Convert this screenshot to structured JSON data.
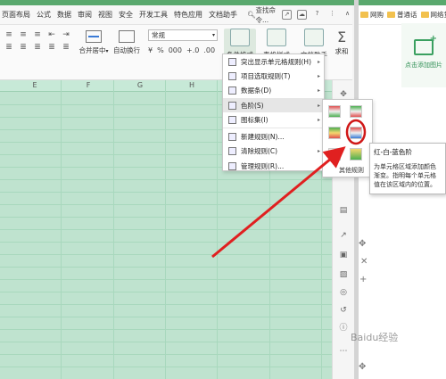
{
  "menu": {
    "items": [
      "页面布局",
      "公式",
      "数据",
      "审阅",
      "视图",
      "安全",
      "开发工具",
      "特色应用",
      "文档助手"
    ],
    "search_label": "查找命令..."
  },
  "ribbon": {
    "merge_label": "合并居中",
    "wrap_label": "自动换行",
    "number_format": "常规",
    "num_buttons": [
      "¥",
      "%",
      "000",
      "+.0",
      ".00"
    ],
    "cond_format_label": "条件格式",
    "table_style_label": "表格样式",
    "doc_helper_label": "文档助手",
    "sum_label": "求和"
  },
  "sheet": {
    "columns": [
      "E",
      "F",
      "G",
      "H"
    ]
  },
  "cond_menu": {
    "items": [
      {
        "label": "突出显示单元格规则(H)",
        "submenu": true
      },
      {
        "label": "项目选取规则(T)",
        "submenu": true
      },
      {
        "label": "数据条(D)",
        "submenu": true
      },
      {
        "label": "色阶(S)",
        "submenu": true,
        "highlighted": true
      },
      {
        "label": "图标集(I)",
        "submenu": true
      },
      {
        "label": "新建规则(N)...",
        "submenu": false
      },
      {
        "label": "清除规则(C)",
        "submenu": true
      },
      {
        "label": "管理规则(R)...",
        "submenu": false
      }
    ]
  },
  "color_scale": {
    "more_label": "其他规则",
    "selected_index": 4
  },
  "tooltip": {
    "title": "红-白-蓝色阶",
    "body": "为单元格区域添加颜色渐变。指明每个单元格值在该区域内的位置。"
  },
  "panel": {
    "tabs": [
      "网购",
      "普通话",
      "网络货"
    ],
    "add_image_label": "点击添加图片"
  },
  "watermark": "Baidu经验",
  "colors": {
    "sheet_bg": "#bfe3cf",
    "accent_green": "#5aa96e",
    "arrow_red": "#e02020"
  }
}
